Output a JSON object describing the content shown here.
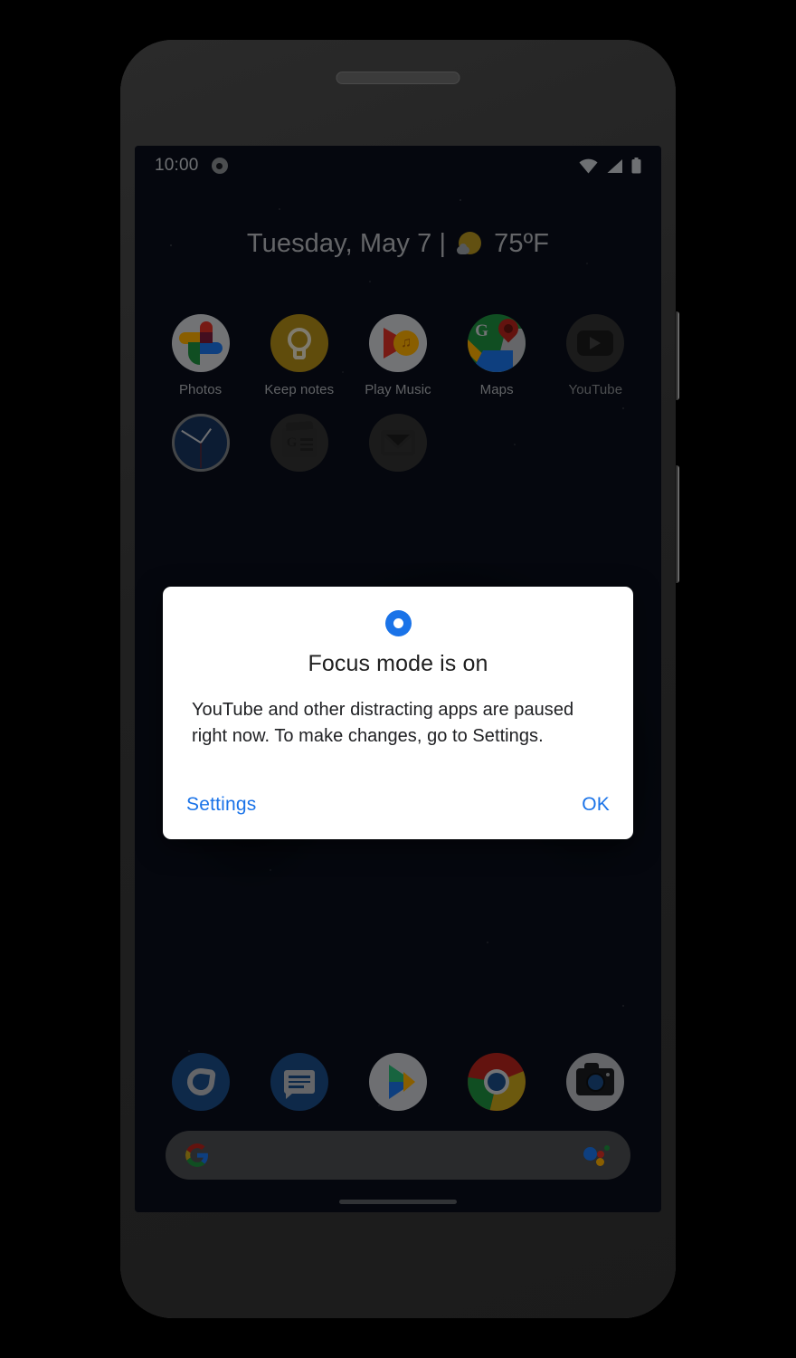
{
  "status_bar": {
    "time": "10:00",
    "focus_indicator_icon": "focus-ring-icon",
    "wifi_icon": "wifi-icon",
    "signal_icon": "cell-signal-icon",
    "battery_icon": "battery-full-icon"
  },
  "widget": {
    "date": "Tuesday, May 7  |",
    "weather_icon": "sun-behind-cloud-icon",
    "temperature": "75ºF"
  },
  "home_screen": {
    "rows": [
      [
        {
          "label": "Photos",
          "icon": "google-photos-icon",
          "dimmed": false
        },
        {
          "label": "Keep notes",
          "icon": "google-keep-icon",
          "dimmed": false
        },
        {
          "label": "Play Music",
          "icon": "google-play-music-icon",
          "dimmed": false
        },
        {
          "label": "Maps",
          "icon": "google-maps-icon",
          "dimmed": false
        },
        {
          "label": "YouTube",
          "icon": "youtube-icon",
          "dimmed": true
        }
      ],
      [
        {
          "label": "",
          "icon": "clock-icon",
          "dimmed": false
        },
        {
          "label": "",
          "icon": "google-news-icon",
          "dimmed": true
        },
        {
          "label": "",
          "icon": "gmail-icon",
          "dimmed": true
        }
      ]
    ]
  },
  "dock": {
    "items": [
      {
        "label": "Phone",
        "icon": "phone-icon"
      },
      {
        "label": "Messages",
        "icon": "messages-icon"
      },
      {
        "label": "Play Store",
        "icon": "google-play-store-icon"
      },
      {
        "label": "Chrome",
        "icon": "chrome-icon"
      },
      {
        "label": "Camera",
        "icon": "camera-icon"
      }
    ]
  },
  "search_bar": {
    "logo_icon": "google-g-icon",
    "assistant_icon": "google-assistant-icon",
    "placeholder": ""
  },
  "dialog": {
    "icon": "focus-mode-ring-icon",
    "title": "Focus mode is on",
    "body": "YouTube and other distracting apps are paused right now. To make changes, go to Settings.",
    "settings_label": "Settings",
    "ok_label": "OK"
  },
  "colors": {
    "accent_blue": "#1a73e8",
    "dialog_background": "#ffffff",
    "title_text": "#1f1f1f",
    "body_text": "#202124",
    "status_text": "#c9ccd1"
  }
}
